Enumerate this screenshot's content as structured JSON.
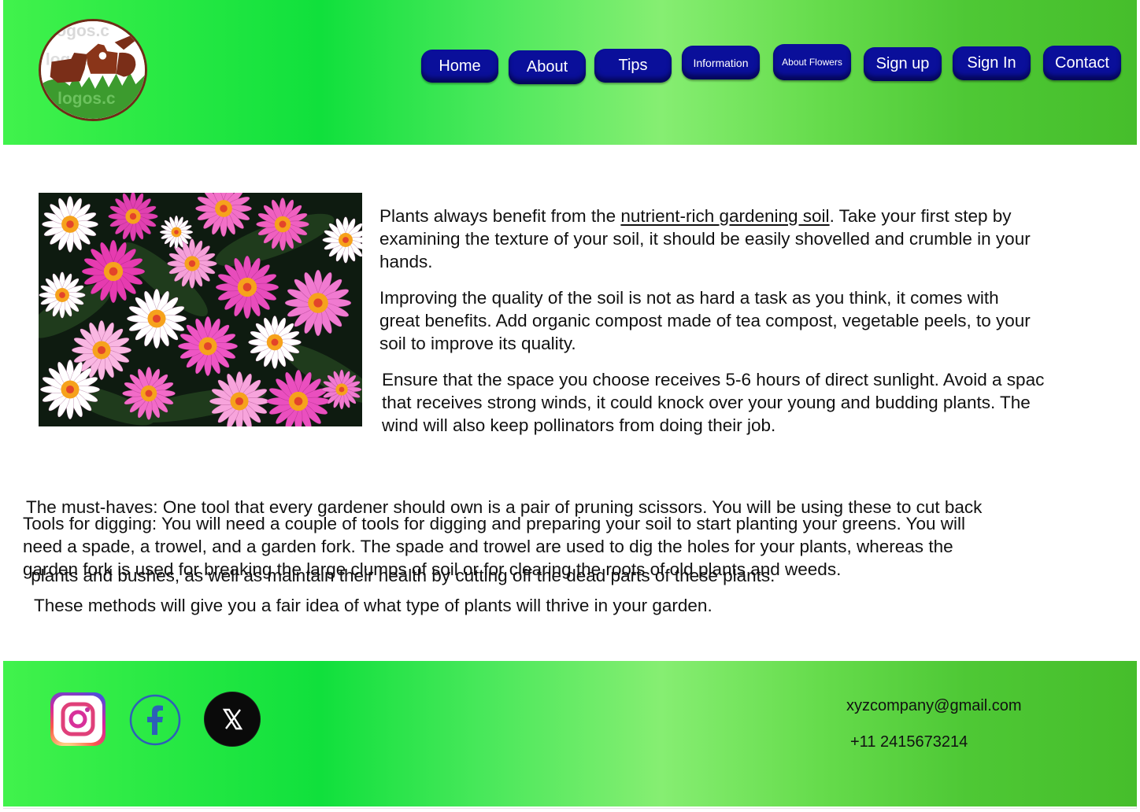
{
  "nav": {
    "home": "Home",
    "about": "About",
    "tips": "Tips",
    "information": "Information",
    "about_flowers": "About Flowers",
    "sign_up": "Sign up",
    "sign_in": "Sign In",
    "contact": "Contact"
  },
  "content": {
    "p1": {
      "before_link": "Plants always benefit from the ",
      "link": "nutrient-rich gardening soil",
      "after_link": ". Take your first step by",
      "line2": "examining the texture of your soil, it should be easily shovelled and crumble in your",
      "line3": "hands."
    },
    "p2": {
      "line1": "Improving the quality of the soil is not as hard a task as you think, it comes with",
      "line2": "great benefits. Add organic compost made of tea compost, vegetable peels, to your",
      "line3": "soil to improve its quality."
    },
    "p3": {
      "line1": "Ensure that the space you choose receives 5-6 hours of direct sunlight. Avoid a spac",
      "line2": "that receives strong winds, it could knock over your young and budding plants. The",
      "line3": "wind will also keep pollinators from doing their job."
    },
    "p4": {
      "line1": "The must-haves: One tool that every gardener should own is a pair of pruning scissors. You will be using these to cut back",
      "line2": " plants and bushes, as well as maintain their health by cutting off the dead parts of these plants."
    },
    "p5": {
      "line1": "Tools for digging: You will need a couple of tools for digging and preparing your soil to start planting your greens. You will",
      "line2": "need a spade, a trowel, and a garden fork. The spade and trowel are used to dig the holes for your plants, whereas the",
      "line3": "garden fork is used for breaking the large clumps of soil or for clearing the roots of old plants and weeds."
    },
    "p6": "These methods will give you a fair idea of what type of plants will thrive in your garden."
  },
  "footer": {
    "email": "xyzcompany@gmail.com",
    "phone": "+11 2415673214",
    "social": [
      "instagram-icon",
      "facebook-icon",
      "x-icon"
    ]
  },
  "colors": {
    "nav_button": "#0a0f9a",
    "band_green": "#10e03c",
    "logo_brown": "#6e2d17"
  }
}
